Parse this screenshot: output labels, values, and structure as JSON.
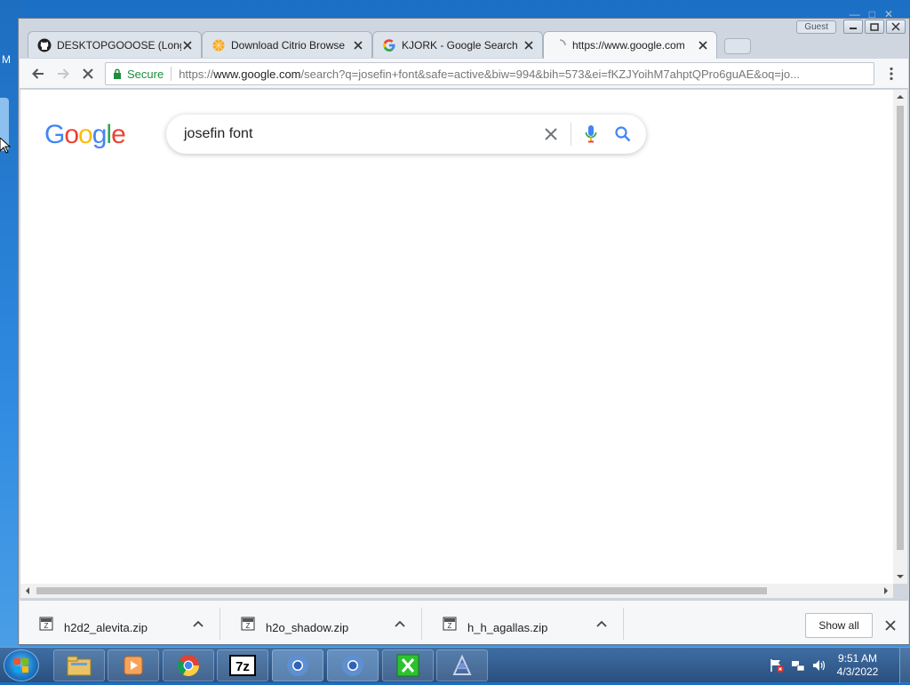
{
  "desktop": {
    "edge_letter": "M"
  },
  "window": {
    "guest_label": "Guest",
    "tabs": [
      {
        "title": "DESKTOPGOOOSE (Long",
        "icon": "github-icon"
      },
      {
        "title": "Download Citrio Browse",
        "icon": "citrio-icon"
      },
      {
        "title": "KJORK - Google Search",
        "icon": "google-g-icon"
      },
      {
        "title": "https://www.google.com",
        "icon": "loading-spinner-icon",
        "active": true
      }
    ]
  },
  "toolbar": {
    "secure_label": "Secure",
    "url_scheme": "https://",
    "url_host": "www.google.com",
    "url_rest": "/search?q=josefin+font&safe=active&biw=994&bih=573&ei=fKZJYoihM7ahptQPro6guAE&oq=jo..."
  },
  "page": {
    "logo_letters": [
      {
        "char": "G",
        "color": "#4285F4"
      },
      {
        "char": "o",
        "color": "#EA4335"
      },
      {
        "char": "o",
        "color": "#FBBC05"
      },
      {
        "char": "g",
        "color": "#4285F4"
      },
      {
        "char": "l",
        "color": "#34A853"
      },
      {
        "char": "e",
        "color": "#EA4335"
      }
    ],
    "search_query": "josefin font"
  },
  "downloads": {
    "items": [
      {
        "name": "h2d2_alevita.zip"
      },
      {
        "name": "h2o_shadow.zip"
      },
      {
        "name": "h_h_agallas.zip"
      }
    ],
    "show_all_label": "Show all"
  },
  "taskbar": {
    "apps": [
      "explorer-icon",
      "media-player-icon",
      "chrome-icon",
      "7zip-icon",
      "chromium-icon",
      "chromium-icon",
      "excel-icon",
      "font-app-icon"
    ],
    "clock_time": "9:51 AM",
    "clock_date": "4/3/2022"
  }
}
